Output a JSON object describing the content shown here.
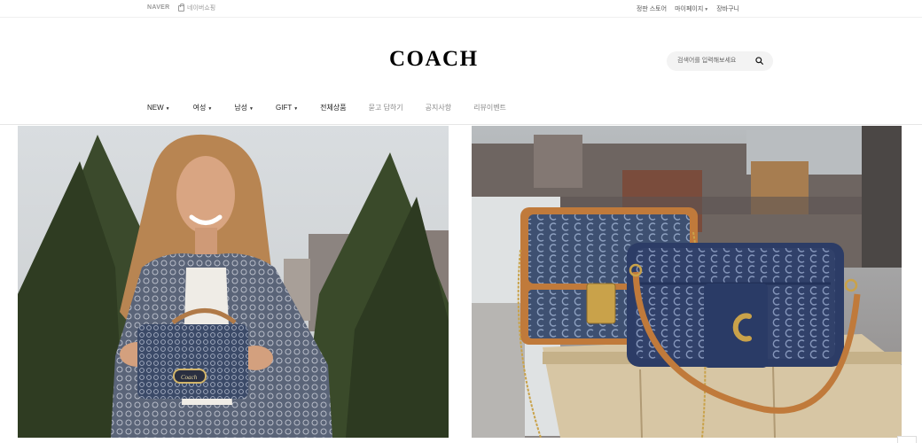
{
  "topbar": {
    "naver_logo": "NAVER",
    "store_link": "네이버쇼핑",
    "links": [
      "정판 스토어",
      "마이페이지",
      "장바구니"
    ]
  },
  "header": {
    "brand": "COACH",
    "search_placeholder": "검색어를 입력해보세요"
  },
  "nav": {
    "items": [
      {
        "label": "NEW",
        "dropdown": true
      },
      {
        "label": "여성",
        "dropdown": true
      },
      {
        "label": "남성",
        "dropdown": true
      },
      {
        "label": "GIFT",
        "dropdown": true
      },
      {
        "label": "전체상품",
        "dropdown": false
      },
      {
        "label": "묻고 답하기",
        "dropdown": false
      },
      {
        "label": "공지사항",
        "dropdown": false
      },
      {
        "label": "리뷰이벤트",
        "dropdown": false
      }
    ]
  },
  "colors": {
    "denim": "#3d4f70",
    "leather_tan": "#c07a3b",
    "gold": "#c9a24a"
  },
  "banners": [
    {
      "icon": "woman-with-signature-bag-photo"
    },
    {
      "icon": "signature-denim-bags-photo"
    }
  ]
}
